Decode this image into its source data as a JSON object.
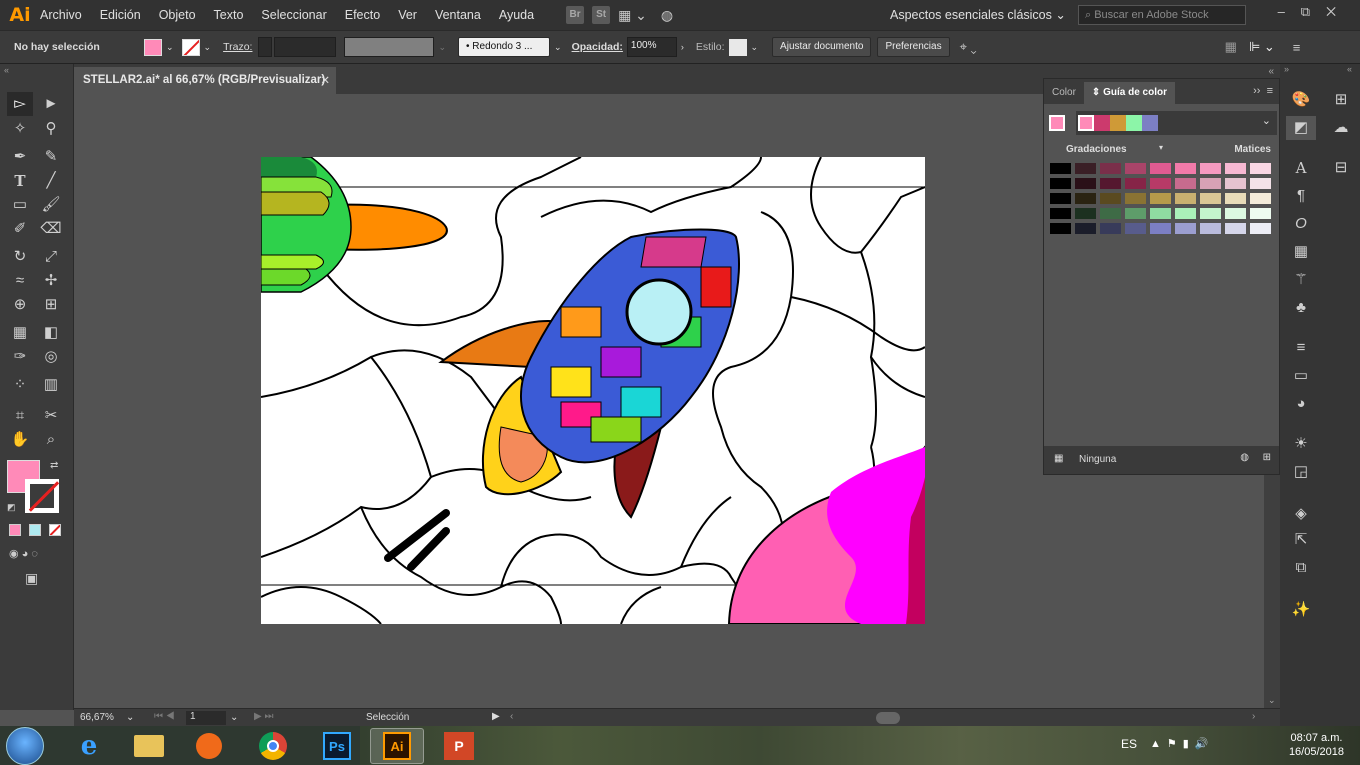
{
  "app": {
    "logo": "Ai"
  },
  "menu": [
    "Archivo",
    "Edición",
    "Objeto",
    "Texto",
    "Seleccionar",
    "Efecto",
    "Ver",
    "Ventana",
    "Ayuda"
  ],
  "menu_icons": [
    "Br",
    "St",
    "arrange-documents-icon",
    "gpu-icon"
  ],
  "workspace": "Aspectos esenciales clásicos",
  "stock_search": {
    "placeholder": "Buscar en Adobe Stock"
  },
  "control": {
    "selection": "No hay selección",
    "fill_color": "#ff8ab8",
    "stroke_label": "Trazo:",
    "brush": "Redondo 3 ...",
    "opacity_label": "Opacidad:",
    "opacity_value": "100%",
    "style_label": "Estilo:",
    "fit_doc": "Ajustar documento",
    "preferences": "Preferencias"
  },
  "document": {
    "tab": "STELLAR2.ai* al 66,67% (RGB/Previsualizar)"
  },
  "status": {
    "zoom": "66,67%",
    "page": "1",
    "tool": "Selección"
  },
  "color_panel": {
    "tabs": [
      "Color",
      "Guía de color"
    ],
    "active_tab": "Guía de color",
    "base_color": "#ff8ab8",
    "harmony": [
      "#ff8ab8",
      "#cc3a6d",
      "#cf9a37",
      "#8cf5a8",
      "#7c7fc4"
    ],
    "gradations": "Gradaciones",
    "shades": "Matices",
    "footer": "Ninguna",
    "grid": [
      [
        "#000000",
        "#3a1f26",
        "#7a2f4a",
        "#a94469",
        "#e05b91",
        "#f27aa9",
        "#f59ac0",
        "#f7b8d2",
        "#f9d6e3"
      ],
      [
        "#000000",
        "#2a1018",
        "#55172f",
        "#862447",
        "#b83a67",
        "#c76b8e",
        "#d7a2b5",
        "#e6c3d0",
        "#f3e2e8"
      ],
      [
        "#000000",
        "#2a2312",
        "#5a4a20",
        "#8a7333",
        "#b69a4a",
        "#c9b070",
        "#d9c795",
        "#e8dcb9",
        "#f4ecda"
      ],
      [
        "#000000",
        "#1c3020",
        "#3e6b46",
        "#5e9d6a",
        "#8fdca1",
        "#aaf0b9",
        "#c4f5cd",
        "#dcf9e1",
        "#eefcf0"
      ],
      [
        "#000000",
        "#1b1d2a",
        "#383b5a",
        "#585c8c",
        "#7c7fc4",
        "#9b9ed0",
        "#b9bbdc",
        "#d5d6ea",
        "#ecedf5"
      ]
    ]
  },
  "taskbar": {
    "apps": [
      "Internet Explorer",
      "Explorador",
      "Media",
      "Chrome",
      "Photoshop",
      "Illustrator",
      "PowerPoint"
    ],
    "lang": "ES",
    "time": "08:07 a.m.",
    "date": "16/05/2018"
  }
}
